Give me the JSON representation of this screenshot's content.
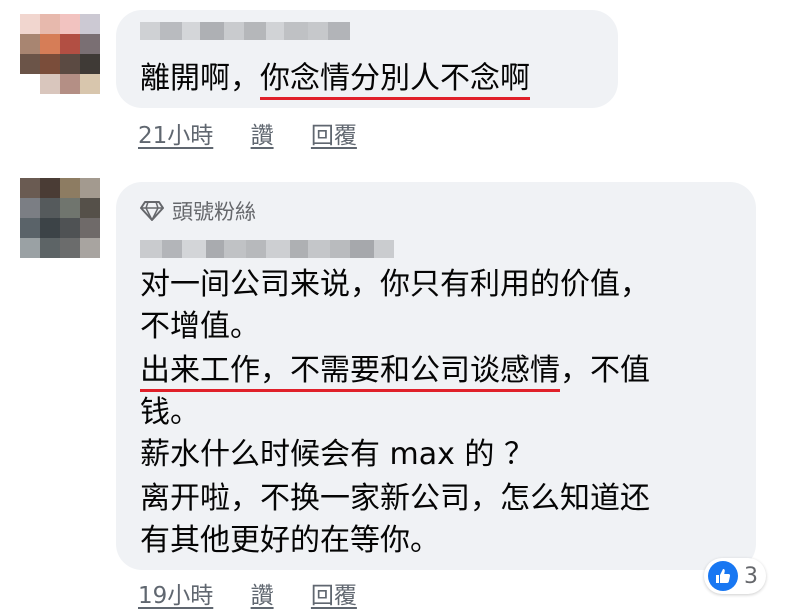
{
  "comments": [
    {
      "text_plain": "離開啊，",
      "text_underlined": "你念情分別人不念啊",
      "time": "21小時",
      "like_label": "讚",
      "reply_label": "回覆"
    },
    {
      "badge": "頭號粉絲",
      "lines": [
        "对一间公司来说，你只有利用的价值，",
        "不增值。",
        "出来工作，不需要和公司谈感情",
        "，不值",
        "钱。",
        "薪水什么时候会有 max 的 ？",
        "离开啦，不换一家新公司，怎么知道还",
        "有其他更好的在等你。"
      ],
      "time": "19小時",
      "like_label": "讚",
      "reply_label": "回覆",
      "reaction_count": "3"
    }
  ],
  "colors": {
    "bubble": "#f0f2f5",
    "underline_highlight": "#e0202a",
    "like_blue": "#1877f2"
  },
  "icons": [
    "diamond-icon",
    "like-thumb-icon"
  ]
}
